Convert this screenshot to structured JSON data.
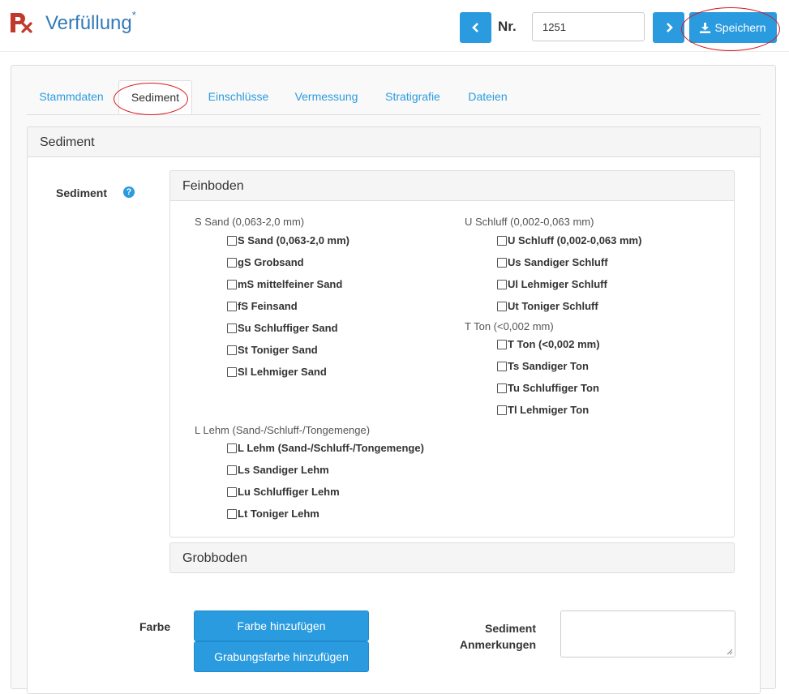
{
  "header": {
    "logo_icon": "map-marker-cross-icon",
    "title": "Verfüllung",
    "title_marker": "*",
    "nr_label": "Nr.",
    "nr_value": "1251",
    "save_label": "Speichern",
    "accent_color": "#2b9bdf",
    "highlight_color": "#d9161b"
  },
  "tabs": [
    {
      "label": "Stammdaten"
    },
    {
      "label": "Sediment",
      "active": true
    },
    {
      "label": "Einschlüsse"
    },
    {
      "label": "Vermessung"
    },
    {
      "label": "Stratigrafie"
    },
    {
      "label": "Dateien"
    }
  ],
  "panel": {
    "heading": "Sediment",
    "field_label": "Sediment",
    "help_icon": "question-circle-icon",
    "feinboden_heading": "Feinboden",
    "grobboden_heading": "Grobboden"
  },
  "groups": {
    "sand": {
      "label": "S Sand (0,063-2,0 mm)",
      "options": [
        "S Sand (0,063-2,0 mm)",
        "gS Grobsand",
        "mS mittelfeiner Sand",
        "fS Feinsand",
        "Su Schluffiger Sand",
        "St Toniger Sand",
        "Sl Lehmiger Sand"
      ]
    },
    "schluff": {
      "label": "U Schluff (0,002-0,063 mm)",
      "options": [
        "U Schluff (0,002-0,063 mm)",
        "Us Sandiger Schluff",
        "Ul Lehmiger Schluff",
        "Ut Toniger Schluff"
      ]
    },
    "ton": {
      "label": "T Ton (<0,002 mm)",
      "options": [
        "T Ton (<0,002 mm)",
        "Ts Sandiger Ton",
        "Tu Schluffiger Ton",
        "Tl Lehmiger Ton"
      ]
    },
    "lehm": {
      "label": "L Lehm (Sand-/Schluff-/Tongemenge)",
      "options": [
        "L Lehm (Sand-/Schluff-/Tongemenge)",
        "Ls Sandiger Lehm",
        "Lu Schluffiger Lehm",
        "Lt Toniger Lehm"
      ]
    }
  },
  "farbe": {
    "label": "Farbe",
    "add_color_label": "Farbe hinzufügen",
    "add_excavation_color_label": "Grabungsfarbe hinzufügen"
  },
  "anmerkungen": {
    "label_line1": "Sediment",
    "label_line2": "Anmerkungen",
    "value": ""
  }
}
